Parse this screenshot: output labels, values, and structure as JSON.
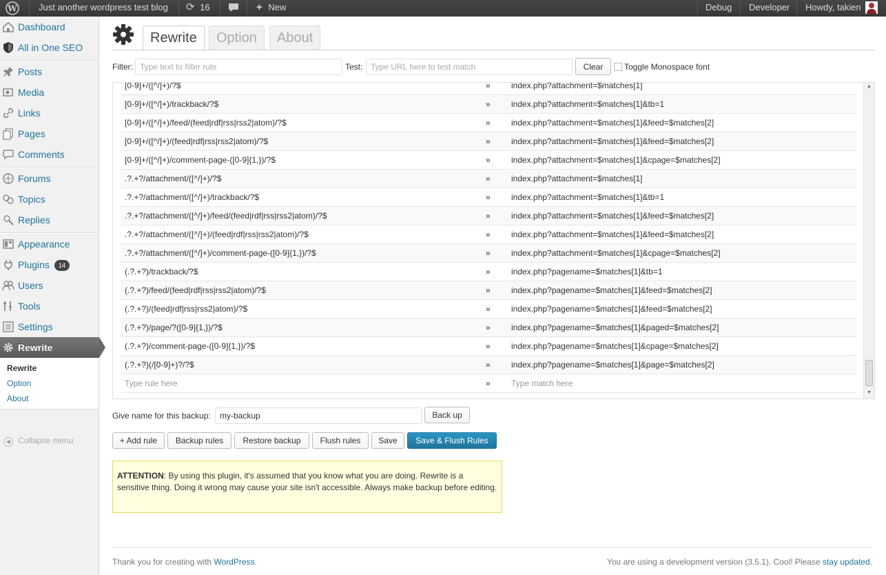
{
  "adminbar": {
    "site_name": "Just another wordpress test blog",
    "updates_count": "16",
    "new_label": "New",
    "debug_label": "Debug",
    "developer_label": "Developer",
    "howdy_label": "Howdy, takien"
  },
  "sidebar": {
    "items": [
      {
        "label": "Dashboard",
        "icon": "dashboard-icon"
      },
      {
        "label": "All in One SEO",
        "icon": "shield-icon"
      },
      {
        "label": "Posts",
        "icon": "pin-icon"
      },
      {
        "label": "Media",
        "icon": "media-icon"
      },
      {
        "label": "Links",
        "icon": "link-icon"
      },
      {
        "label": "Pages",
        "icon": "pages-icon"
      },
      {
        "label": "Comments",
        "icon": "comment-icon"
      },
      {
        "label": "Forums",
        "icon": "forum-icon"
      },
      {
        "label": "Topics",
        "icon": "topics-icon"
      },
      {
        "label": "Replies",
        "icon": "replies-icon"
      },
      {
        "label": "Appearance",
        "icon": "appearance-icon"
      },
      {
        "label": "Plugins",
        "icon": "plugin-icon",
        "badge": "14"
      },
      {
        "label": "Users",
        "icon": "users-icon"
      },
      {
        "label": "Tools",
        "icon": "tools-icon"
      },
      {
        "label": "Settings",
        "icon": "settings-icon"
      },
      {
        "label": "Rewrite",
        "icon": "gear-icon"
      }
    ],
    "submenu": [
      "Rewrite",
      "Option",
      "About"
    ],
    "collapse_label": "Collapse menu"
  },
  "tabs": [
    "Rewrite",
    "Option",
    "About"
  ],
  "filter": {
    "filter_label": "Filter:",
    "filter_placeholder": "Type text to filter rule",
    "test_label": "Test:",
    "test_placeholder": "Type URL here to test match",
    "clear_label": "Clear",
    "monospace_label": "Toggle Monospace font"
  },
  "rules": [
    {
      "rule": "[0-9]+/([^/]+)/?$",
      "match": "index.php?attachment=$matches[1]"
    },
    {
      "rule": "[0-9]+/([^/]+)/trackback/?$",
      "match": "index.php?attachment=$matches[1]&tb=1"
    },
    {
      "rule": "[0-9]+/([^/]+)/feed/(feed|rdf|rss|rss2|atom)/?$",
      "match": "index.php?attachment=$matches[1]&feed=$matches[2]"
    },
    {
      "rule": "[0-9]+/([^/]+)/(feed|rdf|rss|rss2|atom)/?$",
      "match": "index.php?attachment=$matches[1]&feed=$matches[2]"
    },
    {
      "rule": "[0-9]+/([^/]+)/comment-page-([0-9]{1,})/?$",
      "match": "index.php?attachment=$matches[1]&cpage=$matches[2]"
    },
    {
      "rule": ".?.+?/attachment/([^/]+)/?$",
      "match": "index.php?attachment=$matches[1]"
    },
    {
      "rule": ".?.+?/attachment/([^/]+)/trackback/?$",
      "match": "index.php?attachment=$matches[1]&tb=1"
    },
    {
      "rule": ".?.+?/attachment/([^/]+)/feed/(feed|rdf|rss|rss2|atom)/?$",
      "match": "index.php?attachment=$matches[1]&feed=$matches[2]"
    },
    {
      "rule": ".?.+?/attachment/([^/]+)/(feed|rdf|rss|rss2|atom)/?$",
      "match": "index.php?attachment=$matches[1]&feed=$matches[2]"
    },
    {
      "rule": ".?.+?/attachment/([^/]+)/comment-page-([0-9]{1,})/?$",
      "match": "index.php?attachment=$matches[1]&cpage=$matches[2]"
    },
    {
      "rule": "(.?.+?)/trackback/?$",
      "match": "index.php?pagename=$matches[1]&tb=1"
    },
    {
      "rule": "(.?.+?)/feed/(feed|rdf|rss|rss2|atom)/?$",
      "match": "index.php?pagename=$matches[1]&feed=$matches[2]"
    },
    {
      "rule": "(.?.+?)/(feed|rdf|rss|rss2|atom)/?$",
      "match": "index.php?pagename=$matches[1]&feed=$matches[2]"
    },
    {
      "rule": "(.?.+?)/page/?([0-9]{1,})/?$",
      "match": "index.php?pagename=$matches[1]&paged=$matches[2]"
    },
    {
      "rule": "(.?.+?)/comment-page-([0-9]{1,})/?$",
      "match": "index.php?pagename=$matches[1]&cpage=$matches[2]"
    },
    {
      "rule": "(.?.+?)(/[0-9]+)?/?$",
      "match": "index.php?pagename=$matches[1]&page=$matches[2]"
    }
  ],
  "arrow_glyph": "»",
  "new_rule": {
    "rule_placeholder": "Type rule here",
    "match_placeholder": "Type match here"
  },
  "backup": {
    "label": "Give name for this backup:",
    "value": "my-backup",
    "button": "Back up"
  },
  "actions": {
    "add_rule": "+ Add rule",
    "backup_rules": "Backup rules",
    "restore_backup": "Restore backup",
    "flush_rules": "Flush rules",
    "save": "Save",
    "save_flush": "Save & Flush Rules"
  },
  "notice": {
    "strong": "ATTENTION",
    "text": ": By using this plugin, it's assumed that you know what you are doing. Rewrite is a sensitive thing. Doing it wrong may cause your site isn't accessible. Always make backup before editing."
  },
  "footer": {
    "thanks_prefix": "Thank you for creating with ",
    "wordpress_link": "WordPress",
    "thanks_suffix": ".",
    "version_text": "You are using a development version (3.5.1). Cool! Please ",
    "stay_updated_link": "stay updated",
    "version_suffix": "."
  },
  "colors": {
    "link": "#21759b",
    "adminbar": "#464646",
    "primary_button": "#21759b",
    "notice_bg": "#ffffe0"
  }
}
